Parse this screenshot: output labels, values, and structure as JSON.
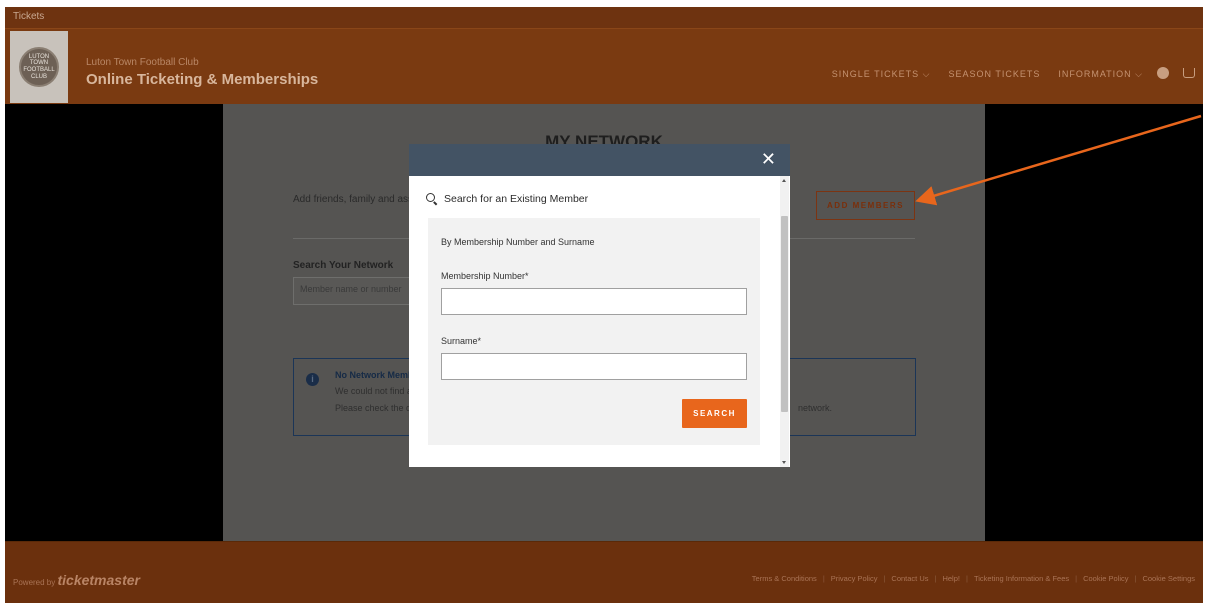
{
  "tabstrip": {
    "tab_label": "Tickets"
  },
  "header": {
    "club_name": "Luton Town Football Club",
    "site_title": "Online Ticketing & Memberships",
    "nav": [
      {
        "label": "SINGLE TICKETS ⌵"
      },
      {
        "label": "SEASON TICKETS"
      },
      {
        "label": "INFORMATION ⌵"
      }
    ],
    "logo_text": "LUTON TOWN FOOTBALL CLUB"
  },
  "page": {
    "title": "MY NETWORK",
    "intro": "Add friends, family and assoc",
    "add_members_label": "ADD MEMBERS",
    "search_label": "Search Your Network",
    "search_placeholder": "Member name or number",
    "alert": {
      "icon": "i",
      "title": "No Network Membe",
      "line1": "We could not find a",
      "line2": "Please check the d",
      "tail": "network."
    }
  },
  "modal": {
    "close_symbol": "✕",
    "section_title": "Search for an Existing Member",
    "sub_heading": "By Membership Number and Surname",
    "membership_label": "Membership Number*",
    "membership_value": "",
    "surname_label": "Surname*",
    "surname_value": "",
    "search_button": "SEARCH"
  },
  "footer": {
    "powered_prefix": "Powered by",
    "brand": "ticketmaster",
    "links": [
      "Terms & Conditions",
      "Privacy Policy",
      "Contact Us",
      "Help!",
      "Ticketing Information & Fees",
      "Cookie Policy",
      "Cookie Settings"
    ]
  },
  "colors": {
    "header_bg": "#7a3a11",
    "modal_head": "#435364",
    "search_button": "#e8661c",
    "arrow": "#e8661c"
  }
}
